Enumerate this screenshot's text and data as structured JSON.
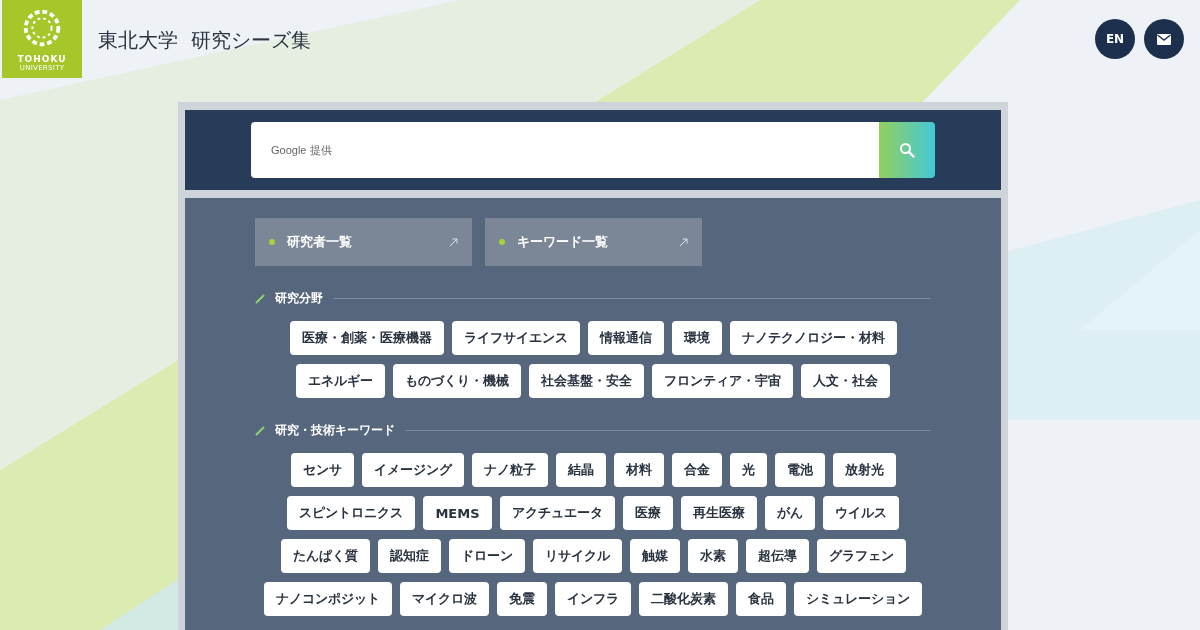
{
  "header": {
    "logo": {
      "name": "TOHOKU",
      "sub": "UNIVERSITY"
    },
    "title": "東北大学  研究シーズ集",
    "buttons": [
      {
        "kind": "language",
        "label": "EN"
      },
      {
        "kind": "mail"
      }
    ]
  },
  "search": {
    "placeholder": "Google 提供"
  },
  "links": [
    {
      "label": "研究者一覧"
    },
    {
      "label": "キーワード一覧"
    }
  ],
  "sections": [
    {
      "heading": "研究分野",
      "tags": [
        "医療・創薬・医療機器",
        "ライフサイエンス",
        "情報通信",
        "環境",
        "ナノテクノロジー・材料",
        "エネルギー",
        "ものづくり・機械",
        "社会基盤・安全",
        "フロンティア・宇宙",
        "人文・社会"
      ]
    },
    {
      "heading": "研究・技術キーワード",
      "tags": [
        "センサ",
        "イメージング",
        "ナノ粒子",
        "結晶",
        "材料",
        "合金",
        "光",
        "電池",
        "放射光",
        "スピントロニクス",
        "MEMS",
        "アクチュエータ",
        "医療",
        "再生医療",
        "がん",
        "ウイルス",
        "たんぱく質",
        "認知症",
        "ドローン",
        "リサイクル",
        "触媒",
        "水素",
        "超伝導",
        "グラフェン",
        "ナノコンポジット",
        "マイクロ波",
        "免震",
        "インフラ",
        "二酸化炭素",
        "食品",
        "シミュレーション"
      ]
    }
  ]
}
